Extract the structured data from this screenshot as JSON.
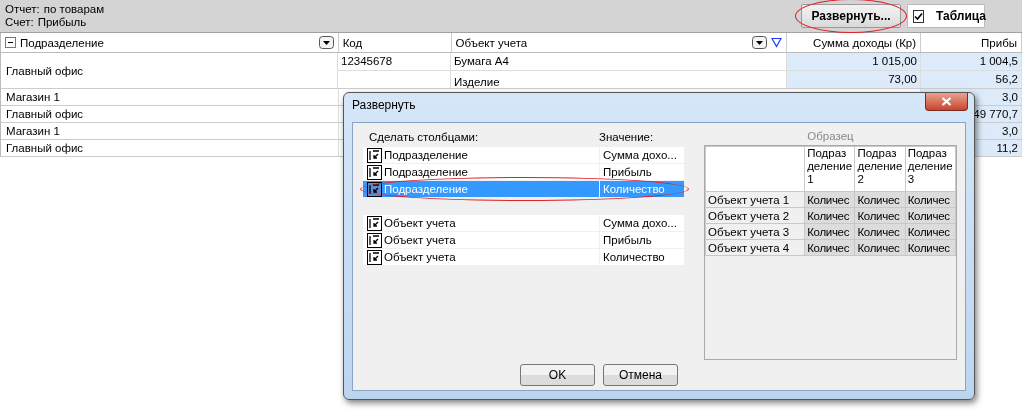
{
  "report": {
    "lines": [
      {
        "label": "Отчет:",
        "value": "по товарам"
      },
      {
        "label": "Счет:",
        "value": "Прибыль"
      }
    ]
  },
  "toolbar": {
    "expand_button": {
      "label": "Развернуть...",
      "circled": true
    },
    "table_toggle": {
      "label": "Таблица",
      "checked": true
    }
  },
  "grid": {
    "columns": [
      {
        "label": "Подразделение",
        "kind": "group"
      },
      {
        "label": "Код",
        "kind": "text"
      },
      {
        "label": "Объект учета",
        "kind": "filter"
      },
      {
        "label": "Сумма доходы (Кр)",
        "kind": "number"
      },
      {
        "label": "Прибы",
        "kind": "number"
      }
    ],
    "rows": [
      {
        "group": "Главный офис",
        "items": [
          {
            "code": "12345678",
            "object": "Бумага А4",
            "income": "1 015,00",
            "profit": "1 004,5"
          },
          {
            "object": "Изделие",
            "income": "73,00",
            "profit": "56,2"
          }
        ]
      },
      {
        "group": "Магазин 1",
        "profit": "3,0"
      },
      {
        "group": "Главный офис",
        "profit": "49 770,7"
      },
      {
        "group": "Магазин 1",
        "profit": "3,0"
      },
      {
        "group": "Главный офис",
        "profit": "11,2"
      }
    ]
  },
  "dialog": {
    "title": "Развернуть",
    "list_headers": [
      "Сделать столбцами:",
      "Значение:"
    ],
    "groups": [
      [
        {
          "field": "Подразделение",
          "value": "Сумма дохо...",
          "selected": false,
          "circled": false
        },
        {
          "field": "Подразделение",
          "value": "Прибыль",
          "selected": false,
          "circled": false
        },
        {
          "field": "Подразделение",
          "value": "Количество",
          "selected": true,
          "circled": true
        }
      ],
      [
        {
          "field": "Объект учета",
          "value": "Сумма дохо...",
          "selected": false,
          "circled": false
        },
        {
          "field": "Объект учета",
          "value": "Прибыль",
          "selected": false,
          "circled": false
        },
        {
          "field": "Объект учета",
          "value": "Количество",
          "selected": false,
          "circled": false
        }
      ]
    ],
    "preview": {
      "title": "Образец",
      "columns": [
        "Подразделение 1",
        "Подразделение 2",
        "Подразделение 3"
      ],
      "rows": [
        {
          "label": "Объект учета 1",
          "cells": [
            "Количес",
            "Количес",
            "Количес"
          ]
        },
        {
          "label": "Объект учета 2",
          "cells": [
            "Количес",
            "Количес",
            "Количес"
          ]
        },
        {
          "label": "Объект учета 3",
          "cells": [
            "Количес",
            "Количес",
            "Количес"
          ]
        },
        {
          "label": "Объект учета 4",
          "cells": [
            "Количес",
            "Количес",
            "Количес"
          ]
        }
      ]
    },
    "buttons": [
      "OK",
      "Отмена"
    ]
  }
}
